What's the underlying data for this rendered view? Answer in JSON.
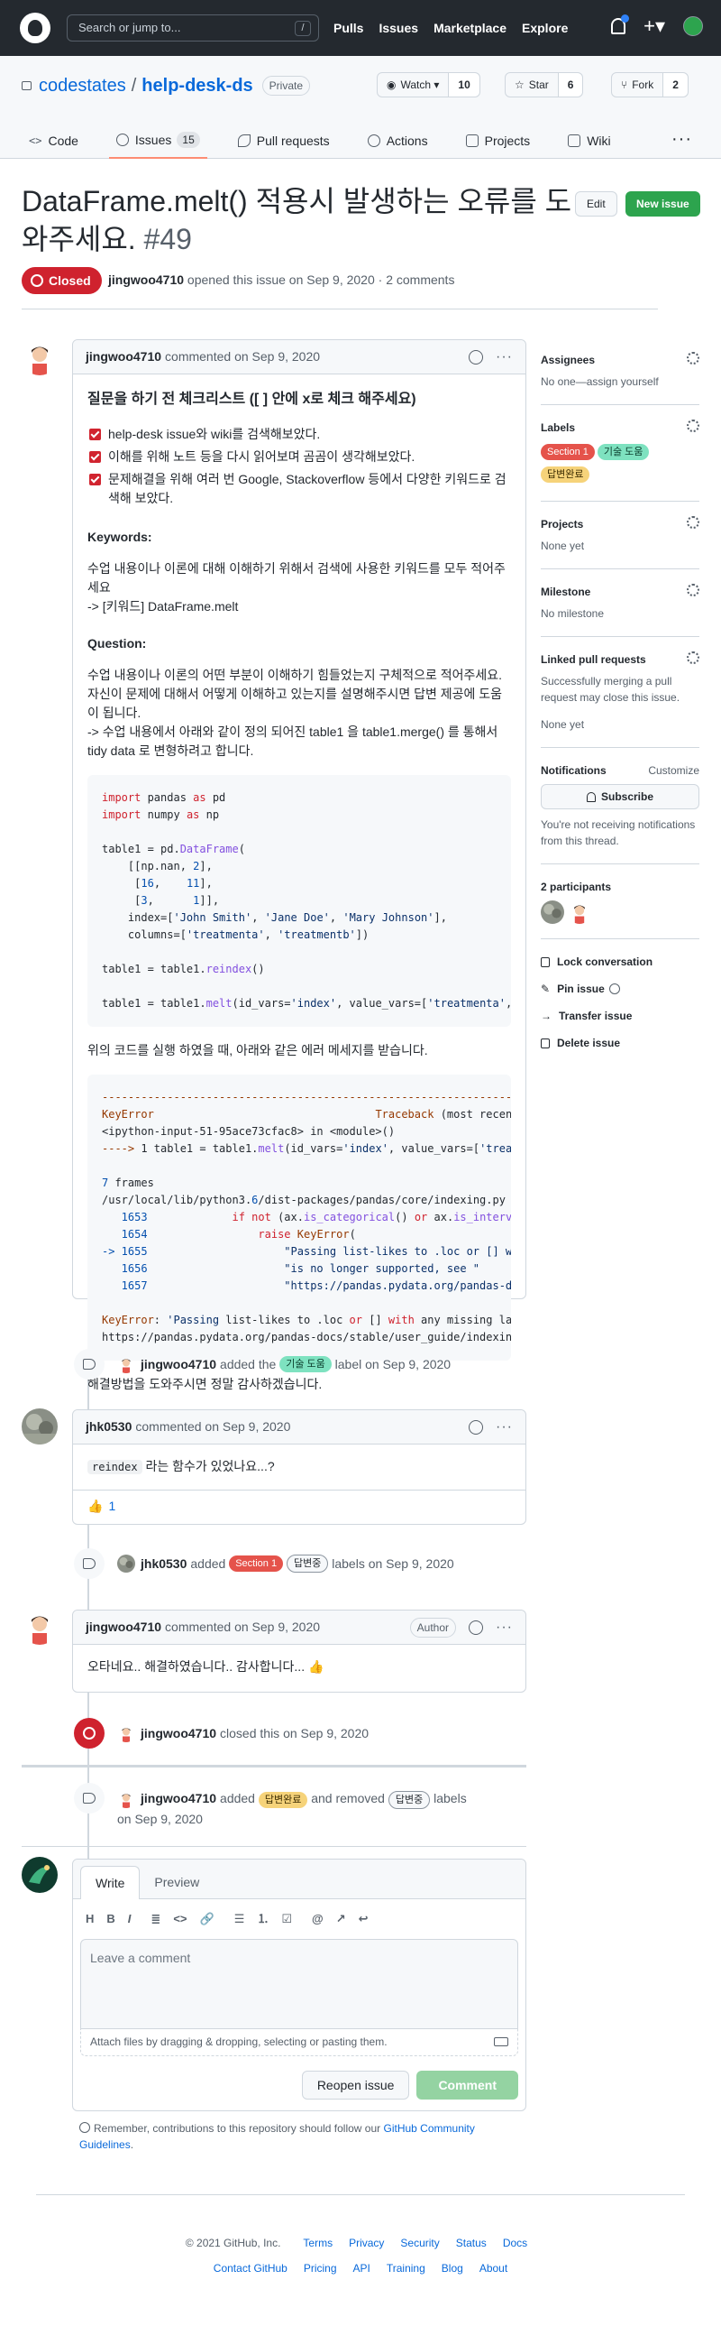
{
  "header": {
    "search_placeholder": "Search or jump to...",
    "slash": "/",
    "nav": [
      "Pulls",
      "Issues",
      "Marketplace",
      "Explore"
    ]
  },
  "repo": {
    "owner": "codestates",
    "sep": "/",
    "name": "help-desk-ds",
    "visibility": "Private",
    "watch_label": "Watch",
    "watch_count": "10",
    "star_label": "Star",
    "star_count": "6",
    "fork_label": "Fork",
    "fork_count": "2"
  },
  "tabs": [
    {
      "label": "Code"
    },
    {
      "label": "Issues",
      "count": "15"
    },
    {
      "label": "Pull requests"
    },
    {
      "label": "Actions"
    },
    {
      "label": "Projects"
    },
    {
      "label": "Wiki"
    }
  ],
  "issue": {
    "title": "DataFrame.melt() 적용시 발생하는 오류를 도와주세요.",
    "number": "#49",
    "edit_label": "Edit",
    "new_issue_label": "New issue",
    "state": "Closed",
    "opener": "jingwoo4710",
    "opened_text": "opened this issue on Sep 9, 2020 · 2 comments"
  },
  "first_comment": {
    "author": "jingwoo4710",
    "when": "commented on Sep 9, 2020",
    "heading": "질문을 하기 전 체크리스트 ([ ] 안에 x로 체크 해주세요)",
    "checklist": [
      "help-desk issue와 wiki를 검색해보았다.",
      "이해를 위해 노트 등을 다시 읽어보며 곰곰이 생각해보았다.",
      "문제해결을 위해 여러 번 Google, Stackoverflow 등에서 다양한 키워드로 검색해 보았다."
    ],
    "keywords_title": "Keywords:",
    "keywords_line1": "수업 내용이나 이론에 대해 이해하기 위해서 검색에 사용한 키워드를 모두 적어주세요",
    "keywords_line2": "-> [키워드] DataFrame.melt",
    "question_title": "Question:",
    "question_text": "수업 내용이나 이론의 어떤 부분이 이해하기 힘들었는지 구체적으로 적어주세요. 자신이 문제에 대해서 어떻게 이해하고 있는지를 설명해주시면 답변 제공에 도움이 됩니다.",
    "question_text2": "-> 수업 내용에서 아래와 같이 정의 되어진 table1 을 table1.merge() 를 통해서 tidy data 로 변형하려고 합니다.",
    "after_code": "위의 코드를 실행 하였을 때, 아래와 같은 에러 메세지를 받습니다.",
    "closing": "해결방법을 도와주시면 정말 감사하겠습니다."
  },
  "event1": {
    "user": "jingwoo4710",
    "pre": "added the",
    "label": "기술 도움",
    "post": "label on Sep 9, 2020"
  },
  "second_comment": {
    "author": "jhk0530",
    "when": "commented on Sep 9, 2020",
    "code": "reindex",
    "text": "라는 함수가 있었나요...?",
    "reaction": "👍",
    "reaction_count": "1"
  },
  "event2": {
    "user": "jhk0530",
    "pre": "added",
    "label1": "Section 1",
    "label2": "답변중",
    "post": "labels on Sep 9, 2020"
  },
  "third_comment": {
    "author": "jingwoo4710",
    "when": "commented on Sep 9, 2020",
    "role": "Author",
    "text": "오타네요.. 해결하였습니다.. 감사합니다... 👍"
  },
  "event3": {
    "user": "jingwoo4710",
    "text": "closed this on Sep 9, 2020"
  },
  "event4": {
    "user": "jingwoo4710",
    "pre": "added",
    "label1": "답변완료",
    "mid": "and removed",
    "label2": "답변중",
    "post": "labels",
    "date": "on Sep 9, 2020"
  },
  "compose": {
    "write": "Write",
    "preview": "Preview",
    "tools": [
      "H",
      "B",
      "I",
      "≣",
      "<>",
      "🔗",
      "☰",
      "⒈",
      "☑",
      "@",
      "↗",
      "↩"
    ],
    "placeholder": "Leave a comment",
    "attach": "Attach files by dragging & dropping, selecting or pasting them.",
    "reopen": "Reopen issue",
    "comment": "Comment"
  },
  "remember": {
    "text": "Remember, contributions to this repository should follow our",
    "link": "GitHub Community Guidelines",
    "end": "."
  },
  "sidebar": {
    "assignees": "Assignees",
    "assignees_text": "No one—assign yourself",
    "labels": "Labels",
    "label_list": [
      {
        "name": "Section 1",
        "bg": "#e5534b",
        "fg": "#ffffff"
      },
      {
        "name": "기술 도움",
        "bg": "#7ee2c0",
        "fg": "#0b3d2c"
      },
      {
        "name": "답변완료",
        "bg": "#f6d37a",
        "fg": "#3a2a00"
      }
    ],
    "projects": "Projects",
    "projects_text": "None yet",
    "milestone": "Milestone",
    "milestone_text": "No milestone",
    "linked": "Linked pull requests",
    "linked_text": "Successfully merging a pull request may close this issue.",
    "linked_none": "None yet",
    "notifications": "Notifications",
    "customize": "Customize",
    "subscribe": "Subscribe",
    "notif_text": "You're not receiving notifications from this thread.",
    "participants": "2 participants",
    "lock": "Lock conversation",
    "pin": "Pin issue",
    "transfer": "Transfer issue",
    "delete": "Delete issue"
  },
  "footer": {
    "copyright": "© 2021 GitHub, Inc.",
    "row1": [
      "Terms",
      "Privacy",
      "Security",
      "Status",
      "Docs"
    ],
    "row2": [
      "Contact GitHub",
      "Pricing",
      "API",
      "Training",
      "Blog",
      "About"
    ]
  },
  "colors": {
    "label_section1": "#e5534b",
    "label_tech": "#7ee2c0",
    "label_done": "#f6d37a",
    "label_pending": "#f6f8fa",
    "closed_red": "#cf222e",
    "green": "#2da44e"
  }
}
